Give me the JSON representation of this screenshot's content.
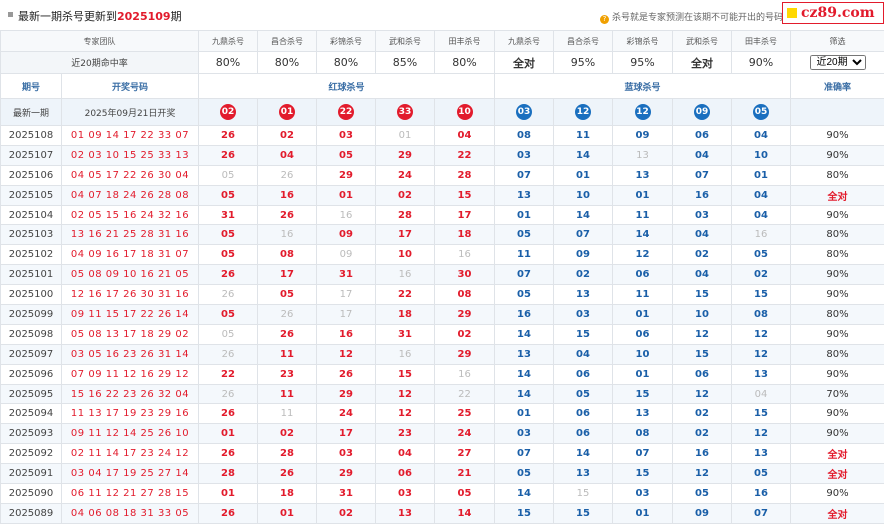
{
  "header": {
    "title_prefix": "最新一期杀号更新到",
    "title_issue": "2025109",
    "title_suffix": "期",
    "note": "杀号就是专家预测在该期不可能开出的号码",
    "logo": "cz89.com"
  },
  "team_row": {
    "label": "专家团队",
    "experts": [
      "九鼎杀号",
      "昌合杀号",
      "彩锦杀号",
      "武和杀号",
      "田丰杀号",
      "九鼎杀号",
      "昌合杀号",
      "彩锦杀号",
      "武和杀号",
      "田丰杀号"
    ],
    "filter_label": "筛选"
  },
  "rate_row": {
    "label": "近20期命中率",
    "rates": [
      "80%",
      "80%",
      "80%",
      "85%",
      "80%",
      "全对",
      "95%",
      "95%",
      "全对",
      "90%"
    ],
    "full_flags": [
      false,
      false,
      false,
      false,
      false,
      true,
      false,
      false,
      true,
      false
    ],
    "select_value": "近20期"
  },
  "col_headers": {
    "issue": "期号",
    "draw": "开奖号码",
    "red": "红球杀号",
    "blue": "蓝球杀号",
    "accuracy": "准确率"
  },
  "latest": {
    "label": "最新一期",
    "date": "2025年09月21日开奖",
    "red": [
      "02",
      "01",
      "22",
      "33",
      "10"
    ],
    "blue": [
      "03",
      "12",
      "12",
      "09",
      "05"
    ]
  },
  "rows": [
    {
      "issue": "2025108",
      "draw": "01 09 14 17 22 33 07",
      "red": [
        "26",
        "02",
        "03",
        "01",
        "04"
      ],
      "blue": [
        "08",
        "11",
        "09",
        "06",
        "04"
      ],
      "accuracy": "90%"
    },
    {
      "issue": "2025107",
      "draw": "02 03 10 15 25 33 13",
      "red": [
        "26",
        "04",
        "05",
        "29",
        "22"
      ],
      "blue": [
        "03",
        "14",
        "13",
        "04",
        "10"
      ],
      "accuracy": "90%"
    },
    {
      "issue": "2025106",
      "draw": "04 05 17 22 26 30 04",
      "red": [
        "05",
        "26",
        "29",
        "24",
        "28"
      ],
      "blue": [
        "07",
        "01",
        "13",
        "07",
        "01"
      ],
      "accuracy": "80%"
    },
    {
      "issue": "2025105",
      "draw": "04 07 18 24 26 28 08",
      "red": [
        "05",
        "16",
        "01",
        "02",
        "15"
      ],
      "blue": [
        "13",
        "10",
        "01",
        "16",
        "04"
      ],
      "accuracy": "全对"
    },
    {
      "issue": "2025104",
      "draw": "02 05 15 16 24 32 16",
      "red": [
        "31",
        "26",
        "16",
        "28",
        "17"
      ],
      "blue": [
        "01",
        "14",
        "11",
        "03",
        "04"
      ],
      "accuracy": "90%"
    },
    {
      "issue": "2025103",
      "draw": "13 16 21 25 28 31 16",
      "red": [
        "05",
        "16",
        "09",
        "17",
        "18"
      ],
      "blue": [
        "05",
        "07",
        "14",
        "04",
        "16"
      ],
      "accuracy": "80%"
    },
    {
      "issue": "2025102",
      "draw": "04 09 16 17 18 31 07",
      "red": [
        "05",
        "08",
        "09",
        "10",
        "16"
      ],
      "blue": [
        "11",
        "09",
        "12",
        "02",
        "05"
      ],
      "accuracy": "80%"
    },
    {
      "issue": "2025101",
      "draw": "05 08 09 10 16 21 05",
      "red": [
        "26",
        "17",
        "31",
        "16",
        "30"
      ],
      "blue": [
        "07",
        "02",
        "06",
        "04",
        "02"
      ],
      "accuracy": "90%"
    },
    {
      "issue": "2025100",
      "draw": "12 16 17 26 30 31 16",
      "red": [
        "26",
        "05",
        "17",
        "22",
        "08"
      ],
      "blue": [
        "05",
        "13",
        "11",
        "15",
        "15"
      ],
      "accuracy": "90%"
    },
    {
      "issue": "2025099",
      "draw": "09 11 15 17 22 26 14",
      "red": [
        "05",
        "26",
        "17",
        "18",
        "29"
      ],
      "blue": [
        "16",
        "03",
        "01",
        "10",
        "08"
      ],
      "accuracy": "80%"
    },
    {
      "issue": "2025098",
      "draw": "05 08 13 17 18 29 02",
      "red": [
        "05",
        "26",
        "16",
        "31",
        "02"
      ],
      "blue": [
        "14",
        "15",
        "06",
        "12",
        "12"
      ],
      "accuracy": "90%"
    },
    {
      "issue": "2025097",
      "draw": "03 05 16 23 26 31 14",
      "red": [
        "26",
        "11",
        "12",
        "16",
        "29"
      ],
      "blue": [
        "13",
        "04",
        "10",
        "15",
        "12"
      ],
      "accuracy": "80%"
    },
    {
      "issue": "2025096",
      "draw": "07 09 11 12 16 29 12",
      "red": [
        "22",
        "23",
        "26",
        "15",
        "16"
      ],
      "blue": [
        "14",
        "06",
        "01",
        "06",
        "13"
      ],
      "accuracy": "90%"
    },
    {
      "issue": "2025095",
      "draw": "15 16 22 23 26 32 04",
      "red": [
        "26",
        "11",
        "29",
        "12",
        "22"
      ],
      "blue": [
        "14",
        "05",
        "15",
        "12",
        "04"
      ],
      "accuracy": "70%"
    },
    {
      "issue": "2025094",
      "draw": "11 13 17 19 23 29 16",
      "red": [
        "26",
        "11",
        "24",
        "12",
        "25"
      ],
      "blue": [
        "01",
        "06",
        "13",
        "02",
        "15"
      ],
      "accuracy": "90%"
    },
    {
      "issue": "2025093",
      "draw": "09 11 12 14 25 26 10",
      "red": [
        "01",
        "02",
        "17",
        "23",
        "24"
      ],
      "blue": [
        "03",
        "06",
        "08",
        "02",
        "12"
      ],
      "accuracy": "90%"
    },
    {
      "issue": "2025092",
      "draw": "02 11 14 17 23 24 12",
      "red": [
        "26",
        "28",
        "03",
        "04",
        "27"
      ],
      "blue": [
        "07",
        "14",
        "07",
        "16",
        "13"
      ],
      "accuracy": "全对"
    },
    {
      "issue": "2025091",
      "draw": "03 04 17 19 25 27 14",
      "red": [
        "28",
        "26",
        "29",
        "06",
        "21"
      ],
      "blue": [
        "05",
        "13",
        "15",
        "12",
        "05"
      ],
      "accuracy": "全对"
    },
    {
      "issue": "2025090",
      "draw": "06 11 12 21 27 28 15",
      "red": [
        "01",
        "18",
        "31",
        "03",
        "05"
      ],
      "blue": [
        "14",
        "15",
        "03",
        "05",
        "16"
      ],
      "accuracy": "90%"
    },
    {
      "issue": "2025089",
      "draw": "04 06 08 18 31 33 05",
      "red": [
        "26",
        "01",
        "02",
        "13",
        "14"
      ],
      "blue": [
        "15",
        "15",
        "01",
        "09",
        "07"
      ],
      "accuracy": "全对"
    }
  ],
  "colors": {
    "red": "#e21b2c",
    "blue": "#1a6fbf",
    "hit": "#bbbbbb",
    "header_blue": "#3a6ea5"
  }
}
